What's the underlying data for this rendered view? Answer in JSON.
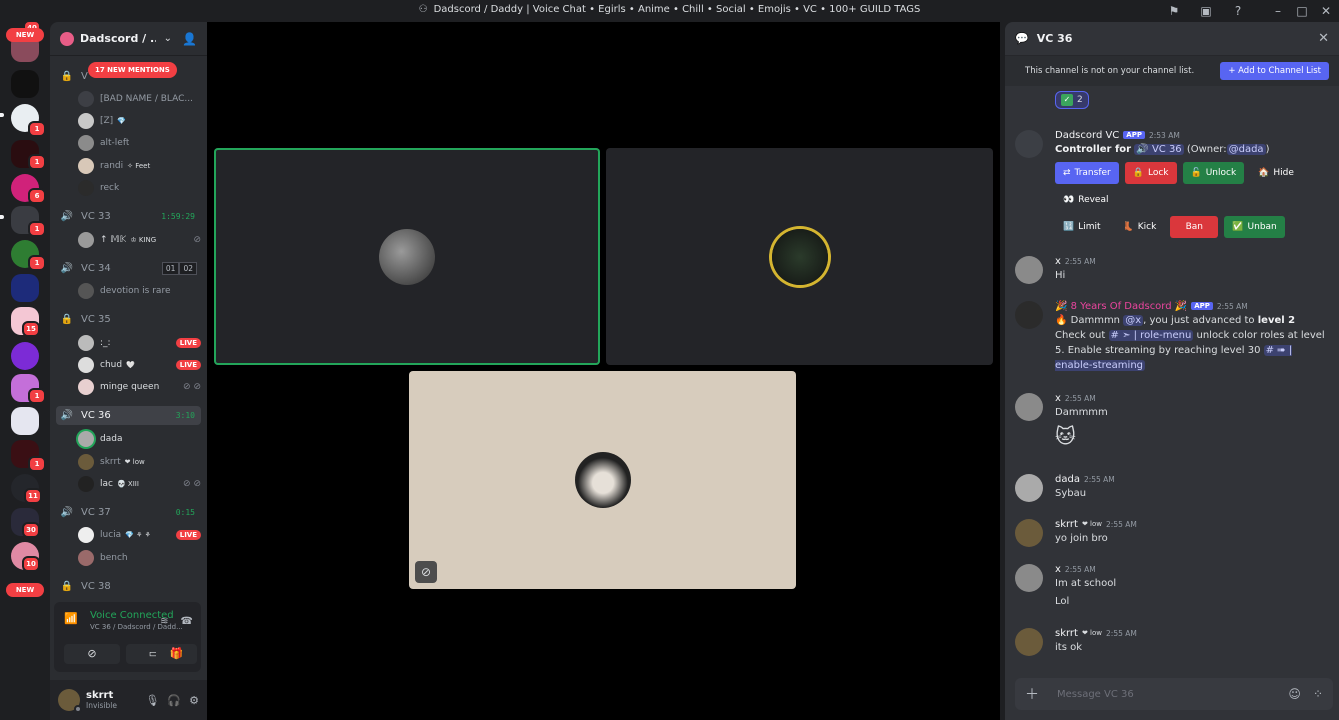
{
  "window": {
    "title": "Dadscord / Daddy | Voice Chat • Egirls • Anime • Chill • Social • Emojis • VC • 100+ GUILD TAGS"
  },
  "rail": {
    "new_label": "NEW",
    "badges": [
      "1",
      "1",
      "6",
      "1",
      "1",
      "15",
      "1",
      "1",
      "11",
      "30",
      "10"
    ],
    "top_badge": "40"
  },
  "guild": {
    "name": "Dadscord / ...",
    "mentions_pill": "17 NEW MENTIONS"
  },
  "channels": {
    "top_users": [
      {
        "name": "[BAD NAME / BLAC..."
      },
      {
        "name": "[Z]",
        "tag": "💎"
      },
      {
        "name": "alt-left"
      },
      {
        "name": "randi",
        "tag": "✧ Feet"
      },
      {
        "name": "reck"
      }
    ],
    "vc33": {
      "name": "VC 33",
      "time": "1:59:29",
      "users": [
        {
          "name": "↑ 𝕄𝕂",
          "tag": "♔ KING"
        }
      ]
    },
    "vc34": {
      "name": "VC 34",
      "counter_a": "01",
      "counter_b": "02",
      "users": [
        {
          "name": "devotion is rare"
        }
      ]
    },
    "vc35": {
      "name": "VC 35",
      "users": [
        {
          "name": ":_:",
          "badge": "LIVE"
        },
        {
          "name": "chud",
          "tag": "🤍",
          "badge": "LIVE"
        },
        {
          "name": "minge queen"
        }
      ]
    },
    "vc36": {
      "name": "VC 36",
      "time": "3:10",
      "users": [
        {
          "name": "dada"
        },
        {
          "name": "skrrt",
          "tag": "❤ low"
        },
        {
          "name": "lac",
          "tag": "💀 XIII"
        }
      ]
    },
    "vc37": {
      "name": "VC 37",
      "time": "0:15",
      "users": [
        {
          "name": "lucia",
          "tag": "💎 ⚘ ⚘",
          "badge": "LIVE"
        },
        {
          "name": "bench"
        }
      ]
    },
    "vc38": {
      "name": "VC 38"
    }
  },
  "voice_panel": {
    "status": "Voice Connected",
    "sub": "VC 36 / Dadscord / Dadd..."
  },
  "user": {
    "name": "skrrt",
    "status": "Invisible"
  },
  "chat": {
    "title": "VC 36",
    "notice": "This channel is not on your channel list.",
    "add_button": "Add to Channel List",
    "reaction_count": "2",
    "composer_placeholder": "Message VC 36",
    "controller": {
      "name": "Dadscord VC",
      "app": "APP",
      "time": "2:53 AM",
      "line_prefix": "Controller for",
      "channel": "🔊 VC 36",
      "owner_prefix": "(Owner:",
      "owner_mention": "@dada",
      "owner_suffix": ")",
      "buttons": {
        "transfer": "Transfer",
        "lock": "Lock",
        "unlock": "Unlock",
        "hide": "Hide",
        "reveal": "Reveal",
        "limit": "Limit",
        "kick": "Kick",
        "ban": "Ban",
        "unban": "Unban"
      }
    },
    "messages": [
      {
        "name": "x",
        "time": "2:55 AM",
        "text": "Hi"
      },
      {
        "name": "🎉 8 Years Of Dadscord 🎉",
        "app": "APP",
        "time": "2:55 AM",
        "text_a": "🔥 Dammmn",
        "mention": "@x",
        "text_b": ", you just advanced to",
        "level": "level 2",
        "text_c": "Check out",
        "ch1": "# ➣ | role-menu",
        "text_d": "unlock color roles at level 5. Enable streaming by reaching level 30",
        "ch2": "# ➠ | enable-streaming"
      },
      {
        "name": "x",
        "time": "2:55 AM",
        "text": "Dammmm"
      },
      {
        "name": "dada",
        "time": "2:55 AM",
        "text": "Sybau"
      },
      {
        "name": "skrrt",
        "tag": "❤ low",
        "time": "2:55 AM",
        "text": "yo join bro"
      },
      {
        "name": "x",
        "time": "2:55 AM",
        "text": "Im at school",
        "text2": "Lol"
      },
      {
        "name": "skrrt",
        "tag": "❤ low",
        "time": "2:55 AM",
        "text": "its ok"
      }
    ]
  }
}
